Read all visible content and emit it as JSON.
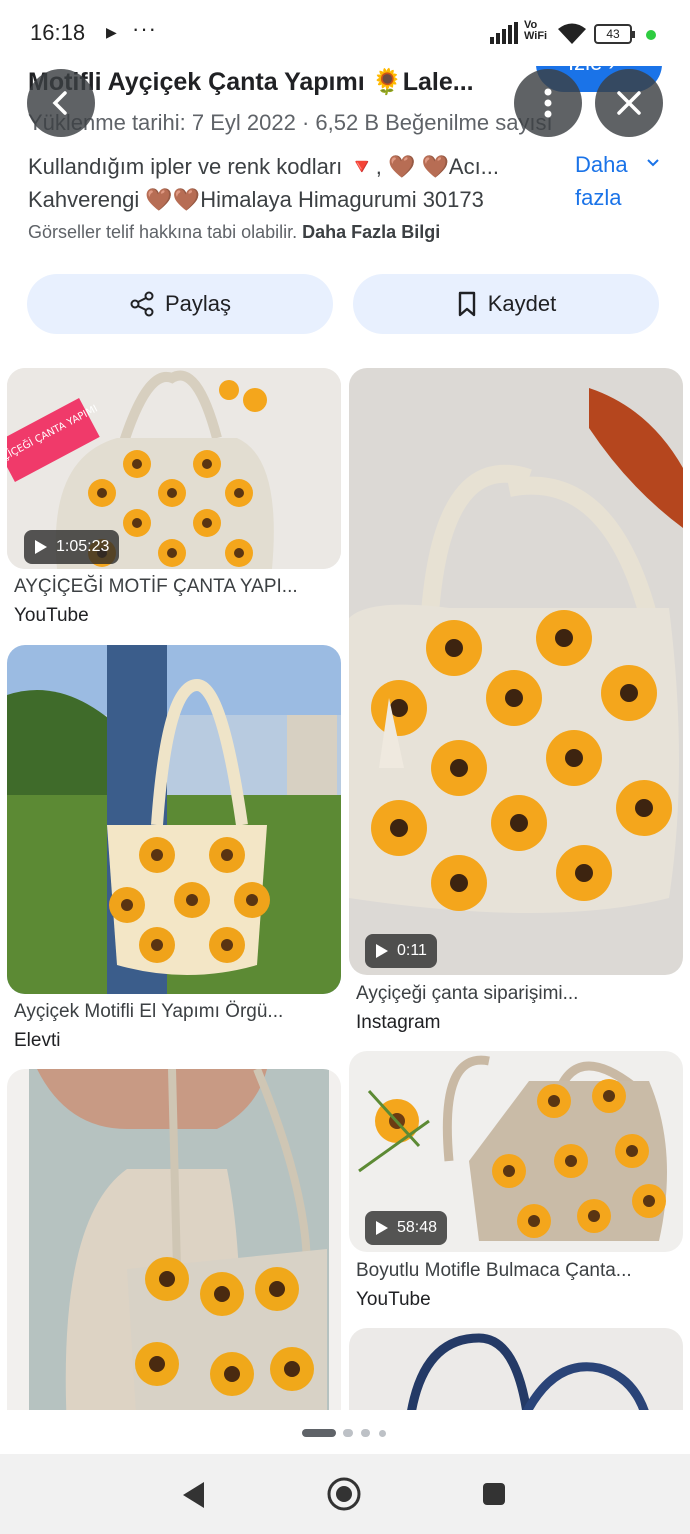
{
  "status_bar": {
    "time": "16:18",
    "battery": "43",
    "network": "Vo\nWiFi"
  },
  "header": {
    "title": "Motifli Ayçiçek Çanta Yapımı 🌻Lale...",
    "upload_label": "Yüklenme tarihi: 7 Eyl 2022",
    "likes": "6,52 B Beğenilme sayısı",
    "watch_label": "İzle",
    "description_line1": "Kullandığım ipler ve renk kodları 🔻, 🤎 🤎Acı...",
    "description_line2": "Kahverengi 🤎🤎Himalaya Himagurumi 30173",
    "more_label_1": "Daha",
    "more_label_2": "fazla",
    "copyright": "Görseller telif hakkına tabi olabilir.",
    "learn_more": "Daha Fazla Bilgi"
  },
  "actions": {
    "share_label": "Paylaş",
    "save_label": "Kaydet"
  },
  "results": [
    {
      "caption": "AYÇİÇEĞİ MOTİF ÇANTA YAPI...",
      "source": "YouTube",
      "duration": "1:05:23",
      "badge": "AYÇİÇEĞİ ÇANTA YAPIMI"
    },
    {
      "caption": "Ayçiçeği çanta siparişimi...",
      "source": "Instagram",
      "duration": "0:11"
    },
    {
      "caption": "Ayçiçek Motifli El Yapımı Örgü...",
      "source": "Elevti"
    },
    {
      "caption": "Boyutlu Motifle Bulmaca Çanta...",
      "source": "YouTube",
      "duration": "58:48"
    }
  ],
  "colors": {
    "accent": "#1a73e8",
    "pill_bg": "#e8f0fe",
    "sunflower": "#f4a61c",
    "bag": "#e9e4da"
  },
  "pager": {
    "count": 4,
    "active": 1
  }
}
